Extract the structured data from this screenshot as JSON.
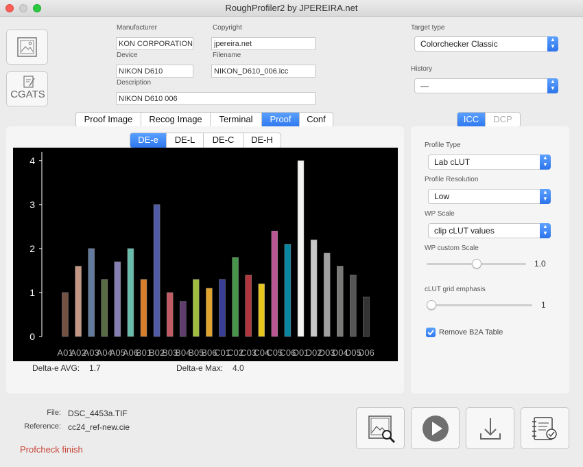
{
  "window": {
    "title": "RoughProfiler2 by JPEREIRA.net"
  },
  "side_buttons": {
    "cgats_label": "CGATS"
  },
  "meta": {
    "manufacturer_label": "Manufacturer",
    "manufacturer_value": "KON CORPORATION",
    "copyright_label": "Copyright",
    "copyright_value": "jpereira.net",
    "device_label": "Device",
    "device_value": "NIKON D610",
    "filename_label": "Filename",
    "filename_value": "NIKON_D610_006.icc",
    "description_label": "Description",
    "description_value": "NIKON D610  006"
  },
  "target": {
    "label": "Target type",
    "value": "Colorchecker Classic"
  },
  "history": {
    "label": "History",
    "value": "—"
  },
  "tabs": [
    "Proof Image",
    "Recog Image",
    "Terminal",
    "Proof",
    "Conf"
  ],
  "active_tab": "Proof",
  "icc_tabs": [
    "ICC",
    "DCP"
  ],
  "de_tabs": [
    "DE-e",
    "DE-L",
    "DE-C",
    "DE-H"
  ],
  "chart_data": {
    "type": "bar",
    "categories": [
      "A01",
      "A02",
      "A03",
      "A04",
      "A05",
      "A06",
      "B01",
      "B02",
      "B03",
      "B04",
      "B05",
      "B06",
      "C01",
      "C02",
      "C03",
      "C04",
      "C05",
      "C06",
      "D01",
      "D02",
      "D03",
      "D04",
      "D05",
      "D06"
    ],
    "values": [
      1.0,
      1.6,
      2.0,
      1.3,
      1.7,
      2.0,
      1.3,
      3.0,
      1.0,
      0.8,
      1.3,
      1.1,
      1.3,
      1.8,
      1.4,
      1.2,
      2.4,
      2.1,
      4.0,
      2.2,
      1.9,
      1.6,
      1.4,
      0.9
    ],
    "colors": [
      "#735244",
      "#c29682",
      "#627a9d",
      "#576c43",
      "#8580b1",
      "#67bdaa",
      "#d67e2c",
      "#505ba6",
      "#c15a63",
      "#5e3c6c",
      "#9dbc40",
      "#e0a32e",
      "#383d96",
      "#469449",
      "#af363c",
      "#e7c71f",
      "#bb5695",
      "#0885a1",
      "#f3f3f2",
      "#c8c8c8",
      "#a0a0a0",
      "#7a7a79",
      "#555555",
      "#343434"
    ],
    "yticks": [
      0,
      1,
      2,
      3,
      4
    ],
    "ylim": [
      0,
      4.2
    ],
    "background": "#000000"
  },
  "stats": {
    "avg_label": "Delta-e AVG:",
    "avg_value": "1.7",
    "max_label": "Delta-e Max:",
    "max_value": "4.0"
  },
  "settings": {
    "profile_type_label": "Profile Type",
    "profile_type_value": "Lab cLUT",
    "profile_res_label": "Profile Resolution",
    "profile_res_value": "Low",
    "wp_scale_label": "WP Scale",
    "wp_scale_value": "clip cLUT values",
    "wp_custom_label": "WP custom Scale",
    "wp_custom_value": "1.0",
    "wp_custom_level": 0.5,
    "clut_label": "cLUT grid emphasis",
    "clut_value": "1",
    "clut_level": 0.0,
    "remove_b2a_label": "Remove B2A Table",
    "remove_b2a_checked": true
  },
  "files": {
    "file_label": "File:",
    "file_value": "DSC_4453a.TIF",
    "ref_label": "Reference:",
    "ref_value": "cc24_ref-new.cie"
  },
  "status": {
    "text": "Profcheck finish",
    "color": "#c8473c"
  }
}
